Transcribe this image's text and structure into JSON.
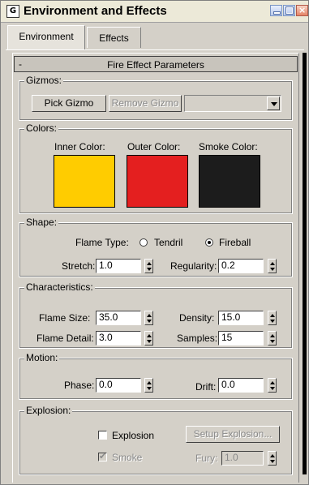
{
  "window": {
    "title": "Environment and Effects",
    "app_icon": "G",
    "controls": {
      "minimize": "minimize-icon",
      "maximize": "maximize-icon",
      "close": "×"
    }
  },
  "tabs": [
    {
      "label": "Environment",
      "active": true
    },
    {
      "label": "Effects",
      "active": false
    }
  ],
  "rollout": {
    "collapse_symbol": "-",
    "title": "Fire Effect Parameters"
  },
  "gizmos": {
    "title": "Gizmos:",
    "pick_label": "Pick Gizmo",
    "remove_label": "Remove Gizmo",
    "dropdown_value": ""
  },
  "colors": {
    "title": "Colors:",
    "inner": {
      "label": "Inner Color:",
      "value": "#ffcc00"
    },
    "outer": {
      "label": "Outer Color:",
      "value": "#e41f1f"
    },
    "smoke": {
      "label": "Smoke Color:",
      "value": "#1c1c1c"
    }
  },
  "shape": {
    "title": "Shape:",
    "flame_type_label": "Flame Type:",
    "options": [
      {
        "label": "Tendril",
        "selected": false
      },
      {
        "label": "Fireball",
        "selected": true
      }
    ],
    "stretch_label": "Stretch:",
    "stretch_value": "1.0",
    "regularity_label": "Regularity:",
    "regularity_value": "0.2"
  },
  "characteristics": {
    "title": "Characteristics:",
    "flame_size_label": "Flame Size:",
    "flame_size_value": "35.0",
    "density_label": "Density:",
    "density_value": "15.0",
    "flame_detail_label": "Flame Detail:",
    "flame_detail_value": "3.0",
    "samples_label": "Samples:",
    "samples_value": "15"
  },
  "motion": {
    "title": "Motion:",
    "phase_label": "Phase:",
    "phase_value": "0.0",
    "drift_label": "Drift:",
    "drift_value": "0.0"
  },
  "explosion": {
    "title": "Explosion:",
    "explosion_label": "Explosion",
    "explosion_checked": false,
    "setup_label": "Setup Explosion...",
    "smoke_label": "Smoke",
    "smoke_checked": true,
    "check_symbol": "✔",
    "fury_label": "Fury:",
    "fury_value": "1.0"
  }
}
